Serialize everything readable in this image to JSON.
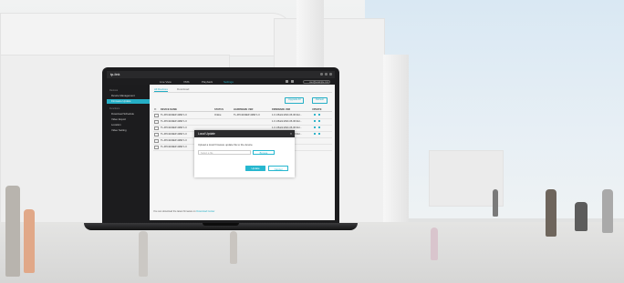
{
  "app": {
    "logo": "tp-link"
  },
  "nav": {
    "tabs": [
      {
        "label": "Live View"
      },
      {
        "label": "VMS"
      },
      {
        "label": "Playback"
      },
      {
        "label": "Settings"
      }
    ],
    "account": "user@example.com"
  },
  "sidebar": {
    "groups": [
      {
        "title": "Devices",
        "items": [
          {
            "label": "Device Management"
          },
          {
            "label": "Firmware Update"
          }
        ]
      },
      {
        "title": "Functions",
        "items": [
          {
            "label": "Download Schedule"
          },
          {
            "label": "Video Export"
          },
          {
            "label": "Location"
          },
          {
            "label": "Video Setting"
          }
        ]
      }
    ]
  },
  "main": {
    "tabs": [
      {
        "label": "All Devices"
      },
      {
        "label": "Download"
      }
    ],
    "actions": [
      {
        "label": "Upgrade All"
      },
      {
        "label": "Refresh"
      }
    ],
    "table": {
      "columns": [
        "DEVICE NAME",
        "STATUS",
        "HARDWARE VER",
        "FIRMWARE VER",
        "UPDATE"
      ],
      "rows": [
        {
          "name": "TL-IPC4243EP-4MW 1.0",
          "status": "Online",
          "hw": "TL-IPC4243EP-4MW 1.0",
          "fw": "1.0.1 Build 2021.06.30 Rel..."
        },
        {
          "name": "TL-IPC4243EP-4MW 1.0",
          "status": "",
          "hw": "",
          "fw": "1.0.1 Build 2021.06.30 Rel..."
        },
        {
          "name": "TL-IPC4243EP-4MW 1.0",
          "status": "",
          "hw": "",
          "fw": "1.0.1 Build 2021.06.30 Rel..."
        },
        {
          "name": "TL-IPC4243EP-4MW 1.0",
          "status": "",
          "hw": "",
          "fw": "1.0.1 Build 2021.06.30 Rel..."
        },
        {
          "name": "TL-IPC4243EP-4MW 1.0",
          "status": "",
          "hw": "",
          "fw": ""
        },
        {
          "name": "TL-IPC4243EP-4MW 1.0",
          "status": "",
          "hw": "",
          "fw": ""
        }
      ]
    },
    "footer_text": "You can download the latest firmware on",
    "footer_link": "Download Center"
  },
  "modal": {
    "title": "Local Update",
    "description": "Upload a local firmware update file to the device.",
    "input_placeholder": "Select a file",
    "browse_label": "Browse",
    "update_label": "Update",
    "cancel_label": "Cancel"
  },
  "colors": {
    "accent": "#27b7cf",
    "dark": "#1e1e20"
  }
}
